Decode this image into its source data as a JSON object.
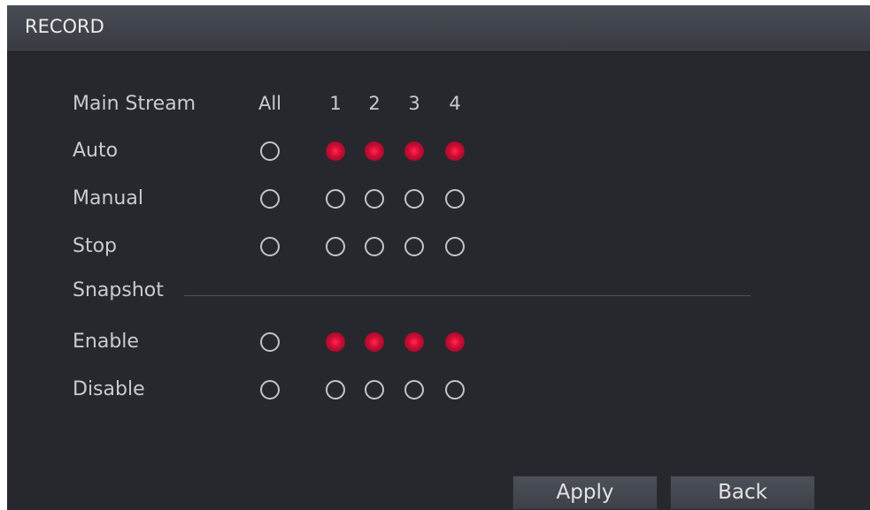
{
  "dialog": {
    "title": "RECORD"
  },
  "main_stream": {
    "header_label": "Main Stream",
    "columns": [
      "All",
      "1",
      "2",
      "3",
      "4"
    ],
    "rows": [
      {
        "label": "Auto",
        "all": false,
        "channels": [
          true,
          true,
          true,
          true
        ]
      },
      {
        "label": "Manual",
        "all": false,
        "channels": [
          false,
          false,
          false,
          false
        ]
      },
      {
        "label": "Stop",
        "all": false,
        "channels": [
          false,
          false,
          false,
          false
        ]
      }
    ]
  },
  "snapshot": {
    "section_label": "Snapshot",
    "rows": [
      {
        "label": "Enable",
        "all": false,
        "channels": [
          true,
          true,
          true,
          true
        ]
      },
      {
        "label": "Disable",
        "all": false,
        "channels": [
          false,
          false,
          false,
          false
        ]
      }
    ]
  },
  "buttons": {
    "apply_label": "Apply",
    "back_label": "Back"
  },
  "colors": {
    "selected_radio": "#e8123d",
    "panel_background": "#26282d",
    "titlebar": "#404349"
  }
}
